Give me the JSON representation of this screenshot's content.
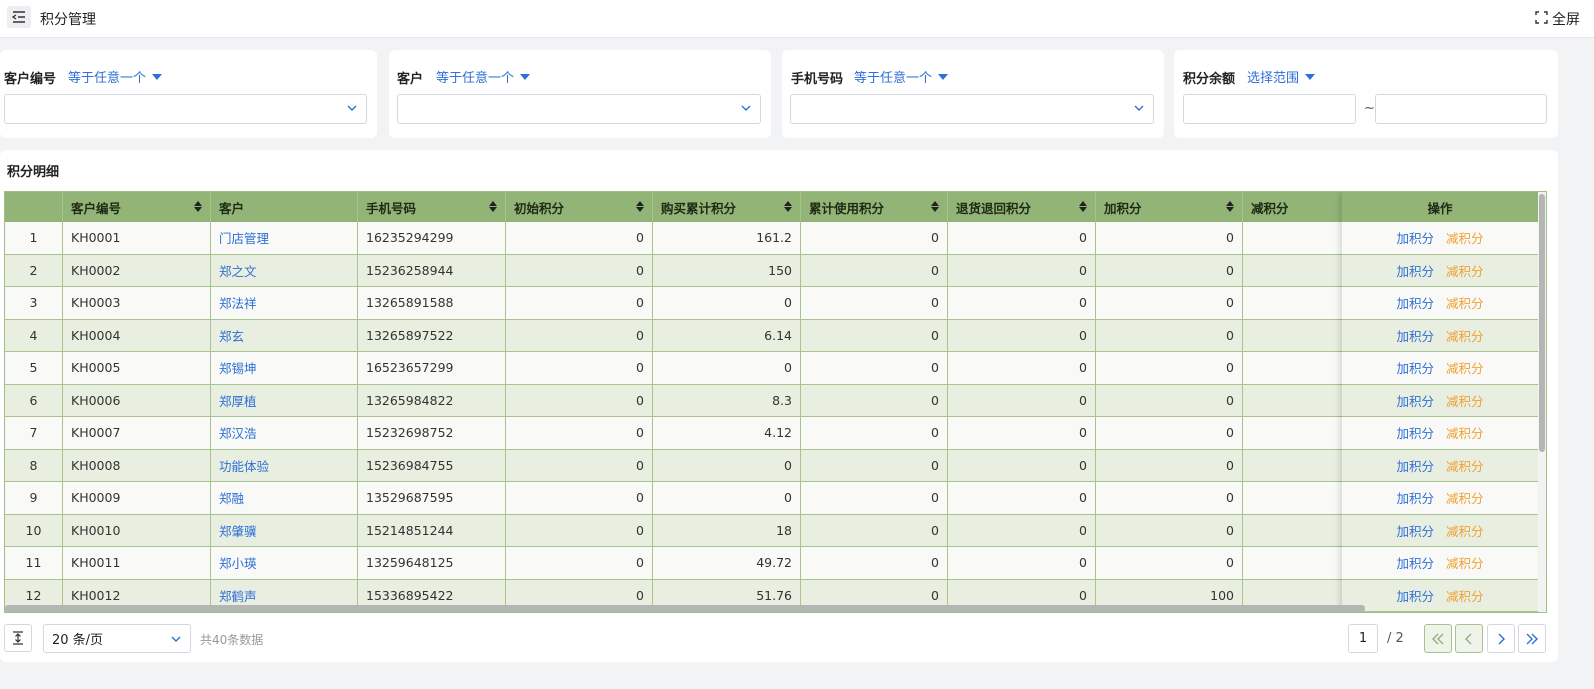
{
  "header": {
    "title": "积分管理",
    "fullscreen_label": "全屏"
  },
  "filters": [
    {
      "label": "客户编号",
      "operator": "等于任意一个"
    },
    {
      "label": "客户",
      "operator": "等于任意一个"
    },
    {
      "label": "手机号码",
      "operator": "等于任意一个"
    },
    {
      "label": "积分余额",
      "operator": "选择范围",
      "range_separator": "~"
    }
  ],
  "table": {
    "title": "积分明细",
    "columns": [
      "",
      "客户编号",
      "客户",
      "手机号码",
      "初始积分",
      "购买累计积分",
      "累计使用积分",
      "退货退回积分",
      "加积分",
      "减积分"
    ],
    "actions_header": "操作",
    "action_add": "加积分",
    "action_sub": "减积分",
    "rows": [
      [
        "1",
        "KH0001",
        "门店管理",
        "16235294299",
        "0",
        "161.2",
        "0",
        "0",
        "0",
        ""
      ],
      [
        "2",
        "KH0002",
        "郑之文",
        "15236258944",
        "0",
        "150",
        "0",
        "0",
        "0",
        ""
      ],
      [
        "3",
        "KH0003",
        "郑法祥",
        "13265891588",
        "0",
        "0",
        "0",
        "0",
        "0",
        ""
      ],
      [
        "4",
        "KH0004",
        "郑玄",
        "13265897522",
        "0",
        "6.14",
        "0",
        "0",
        "0",
        ""
      ],
      [
        "5",
        "KH0005",
        "郑锡坤",
        "16523657299",
        "0",
        "0",
        "0",
        "0",
        "0",
        ""
      ],
      [
        "6",
        "KH0006",
        "郑厚植",
        "13265984822",
        "0",
        "8.3",
        "0",
        "0",
        "0",
        ""
      ],
      [
        "7",
        "KH0007",
        "郑汉浩",
        "15232698752",
        "0",
        "4.12",
        "0",
        "0",
        "0",
        ""
      ],
      [
        "8",
        "KH0008",
        "功能体验",
        "15236984755",
        "0",
        "0",
        "0",
        "0",
        "0",
        ""
      ],
      [
        "9",
        "KH0009",
        "郑融",
        "13529687595",
        "0",
        "0",
        "0",
        "0",
        "0",
        ""
      ],
      [
        "10",
        "KH0010",
        "郑肇骥",
        "15214851244",
        "0",
        "18",
        "0",
        "0",
        "0",
        ""
      ],
      [
        "11",
        "KH0011",
        "郑小瑛",
        "13259648125",
        "0",
        "49.72",
        "0",
        "0",
        "0",
        ""
      ],
      [
        "12",
        "KH0012",
        "郑鹤声",
        "15336895422",
        "0",
        "51.76",
        "0",
        "0",
        "100",
        ""
      ]
    ]
  },
  "pagination": {
    "page_size": "20 条/页",
    "total_text": "共40条数据",
    "current_page": "1",
    "page_count_text": "/ 2"
  },
  "icons": [
    "menu-fold-icon",
    "fullscreen-icon",
    "chevron-down-icon",
    "sort-icon",
    "expand-icon",
    "first-page-icon",
    "prev-page-icon",
    "next-page-icon",
    "last-page-icon"
  ],
  "colors": {
    "accent": "#2f6fd6",
    "header_green": "#93b477",
    "row_alt": "#e8efe0",
    "subtract": "#f0a032"
  }
}
